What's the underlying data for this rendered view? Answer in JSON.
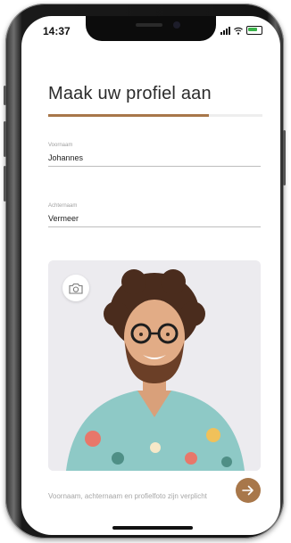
{
  "status_bar": {
    "time": "14:37"
  },
  "header": {
    "title": "Maak uw profiel aan"
  },
  "progress": {
    "value": 0.75
  },
  "form": {
    "first_name": {
      "label": "Voornaam",
      "value": "Johannes"
    },
    "last_name": {
      "label": "Achternaam",
      "value": "Vermeer"
    }
  },
  "photo": {
    "upload_icon": "camera-icon"
  },
  "footer": {
    "hint": "Voornaam, achternaam en profielfoto zijn verplicht",
    "next_icon": "arrow-right-icon"
  },
  "colors": {
    "accent": "#a8774a",
    "text": "#2b2b2b",
    "muted": "#a0a0a0"
  }
}
